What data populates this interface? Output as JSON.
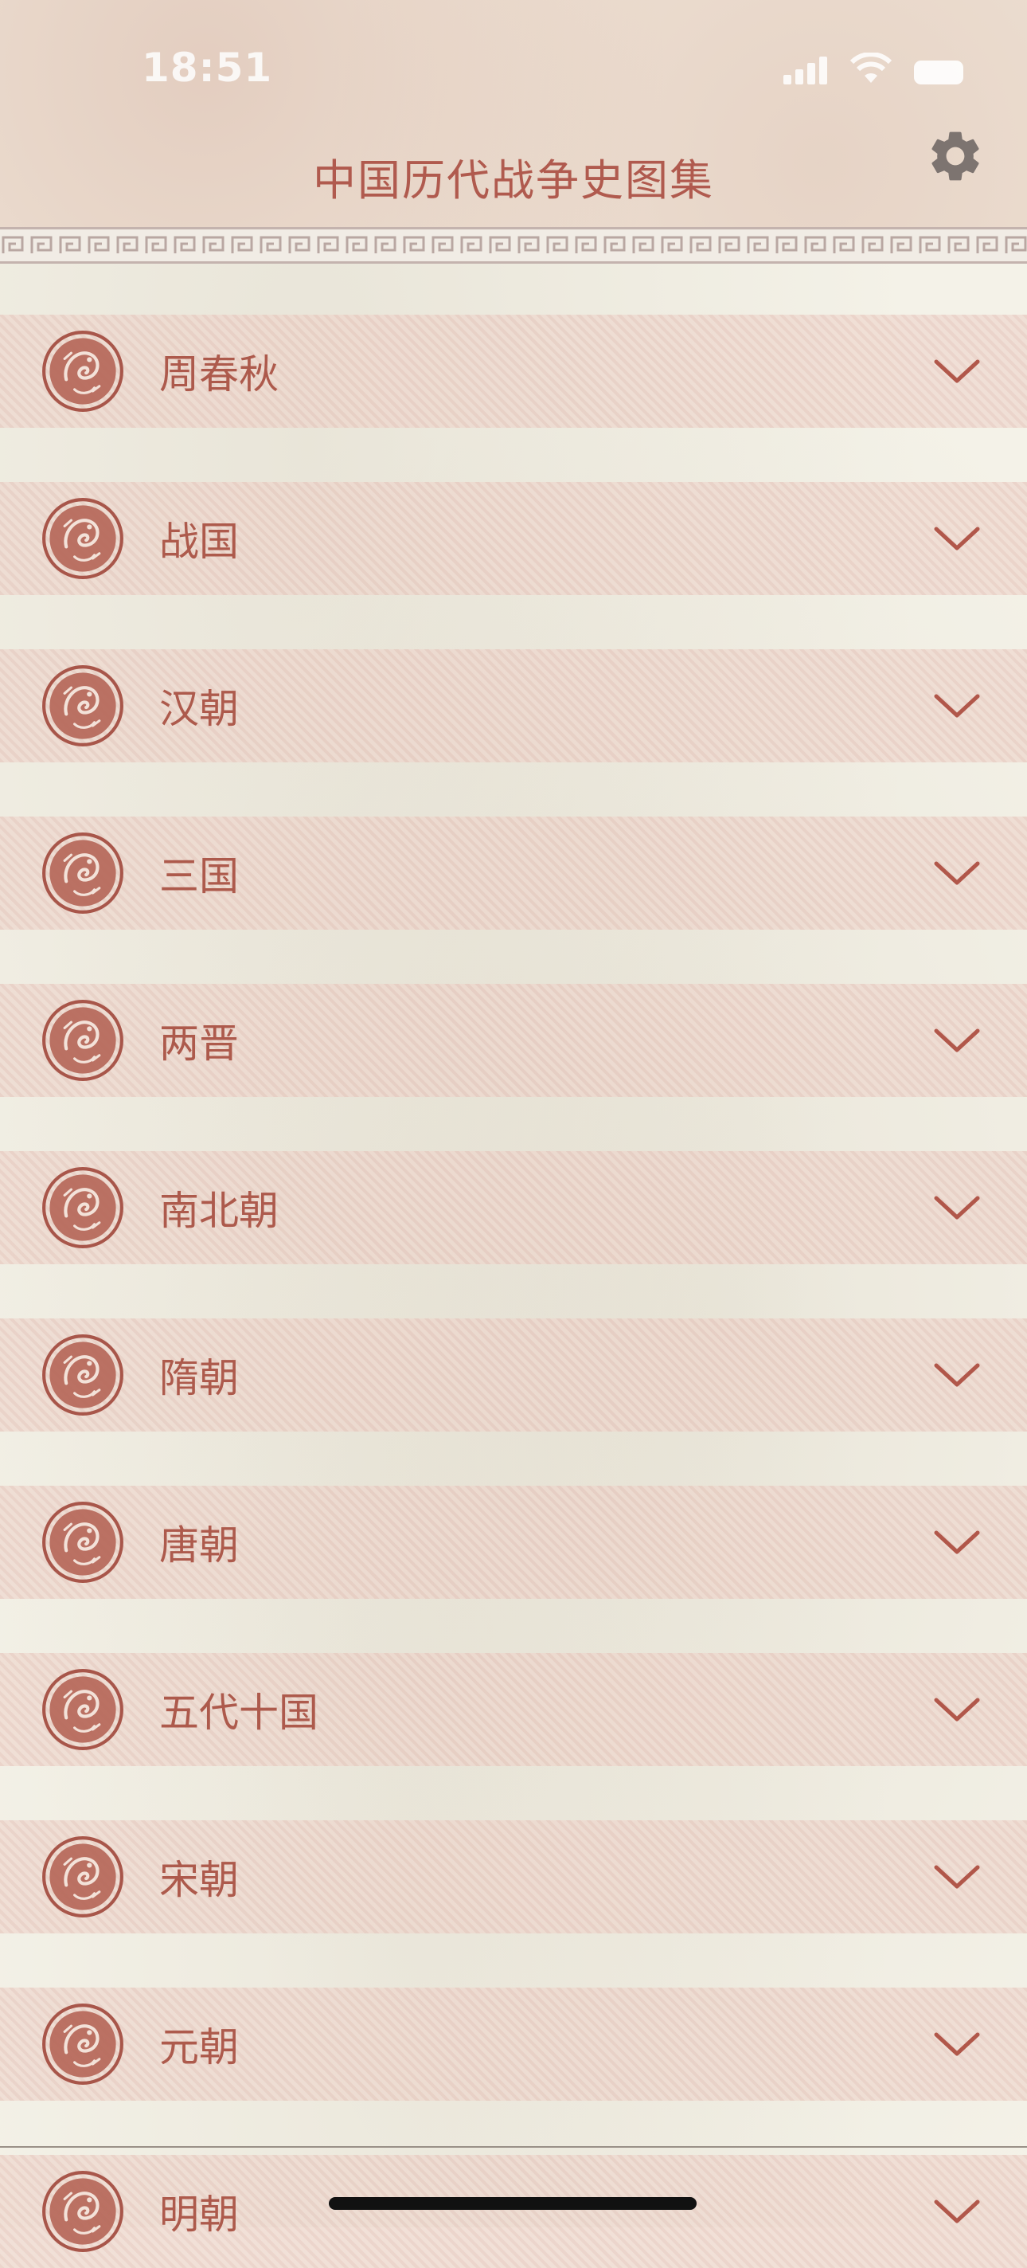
{
  "status_bar": {
    "time": "18:51"
  },
  "header": {
    "title": "中国历代战争史图集",
    "settings_icon": "gear-icon"
  },
  "dynasties": [
    {
      "label": "周春秋"
    },
    {
      "label": "战国"
    },
    {
      "label": "汉朝"
    },
    {
      "label": "三国"
    },
    {
      "label": "两晋"
    },
    {
      "label": "南北朝"
    },
    {
      "label": "隋朝"
    },
    {
      "label": "唐朝"
    },
    {
      "label": "五代十国"
    },
    {
      "label": "宋朝"
    },
    {
      "label": "元朝"
    },
    {
      "label": "明朝"
    }
  ],
  "colors": {
    "accent": "#ad5a4c",
    "row_bg": "#ecd2c8",
    "background": "#f4f2e8"
  }
}
